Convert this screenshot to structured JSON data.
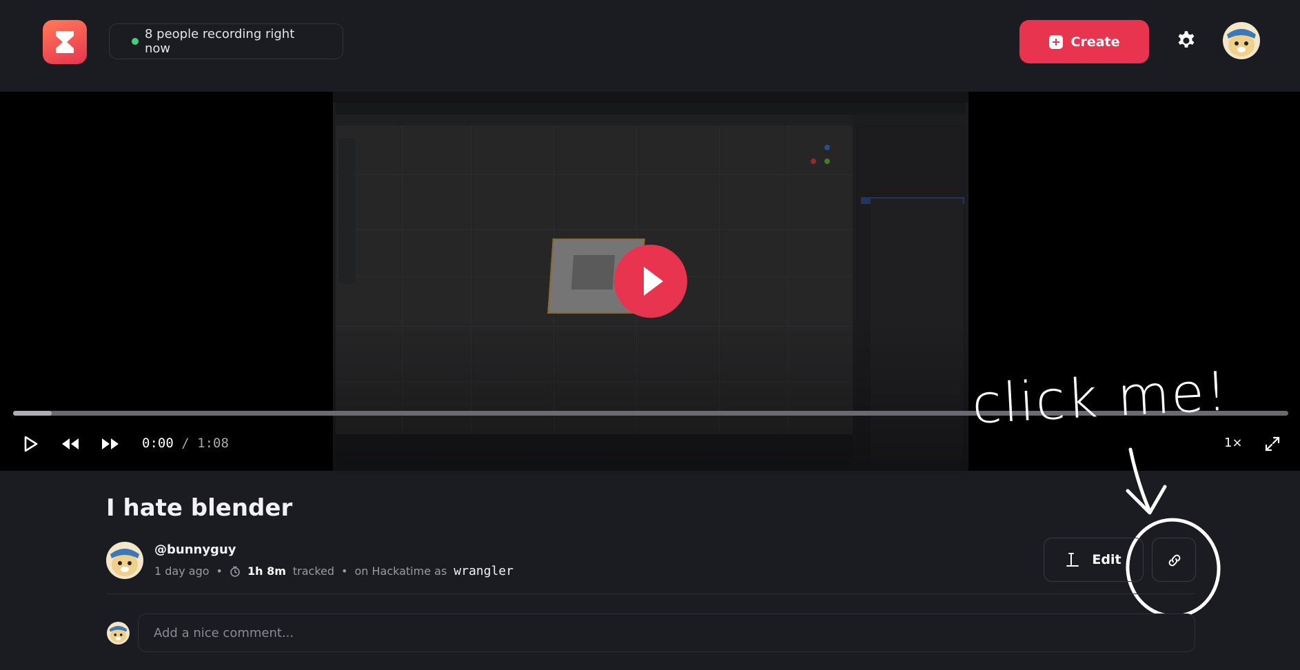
{
  "header": {
    "logo_icon": "hourglass-icon",
    "live_status": "8 people recording right now",
    "create_label": "Create",
    "settings_icon": "gear-icon",
    "accent": "#e8344e",
    "live_color": "#3fd07a"
  },
  "player": {
    "current_time": "0:00",
    "separator": "/",
    "duration": "1:08",
    "progress_fraction": 0.03,
    "speed": "1×"
  },
  "annotation": {
    "text": "click me!"
  },
  "recording": {
    "title": "I hate blender",
    "username": "@bunnyguy",
    "posted": "1 day ago",
    "tracked_time": "1h 8m",
    "tracked_label": "tracked",
    "hackatime_label": "on Hackatime as",
    "hackatime_user": "wrangler",
    "edit_label": "Edit"
  },
  "comments": {
    "placeholder": "Add a nice comment..."
  }
}
